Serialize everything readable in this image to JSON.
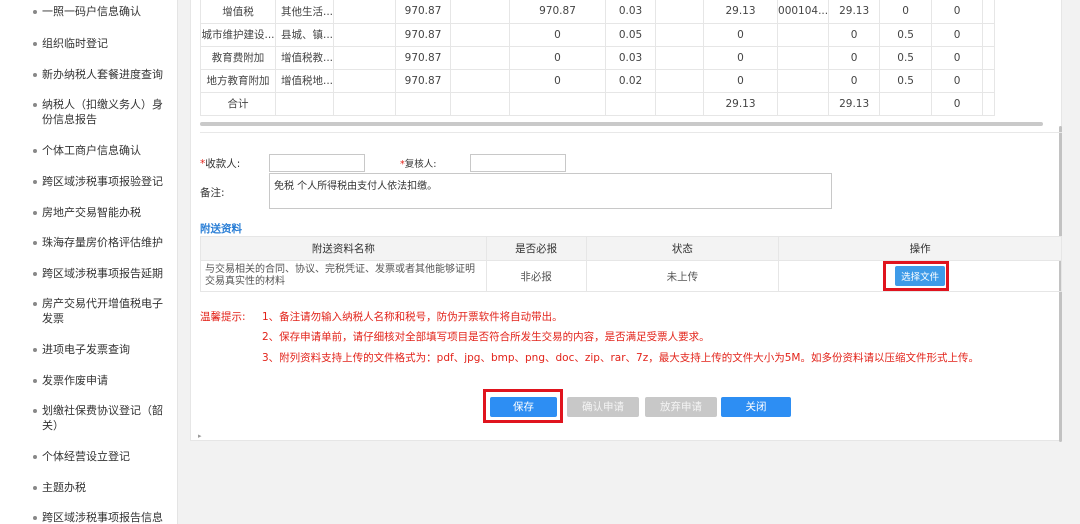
{
  "sidebar": {
    "items": [
      {
        "label": "一照一码户信息确认"
      },
      {
        "label": "组织临时登记"
      },
      {
        "label": "新办纳税人套餐进度查询"
      },
      {
        "label": "纳税人（扣缴义务人）身份信息报告"
      },
      {
        "label": "个体工商户信息确认"
      },
      {
        "label": "跨区域涉税事项报验登记"
      },
      {
        "label": "房地产交易智能办税"
      },
      {
        "label": "珠海存量房价格评估维护"
      },
      {
        "label": "跨区域涉税事项报告延期"
      },
      {
        "label": "房产交易代开增值税电子发票"
      },
      {
        "label": "进项电子发票查询"
      },
      {
        "label": "发票作废申请"
      },
      {
        "label": "划缴社保费协议登记（韶关）"
      },
      {
        "label": "个体经营设立登记"
      },
      {
        "label": "主题办税"
      },
      {
        "label": "跨区域涉税事项报告信息"
      }
    ]
  },
  "tax_table": {
    "rows": [
      [
        "增值税",
        "其他生活...",
        "",
        "970.87",
        "",
        "970.87",
        "0.03",
        "",
        "29.13",
        "000104...",
        "29.13",
        "0",
        "0"
      ],
      [
        "城市维护建设...",
        "县城、镇...",
        "",
        "970.87",
        "",
        "0",
        "0.05",
        "",
        "0",
        "",
        "0",
        "0.5",
        "0"
      ],
      [
        "教育费附加",
        "增值税教...",
        "",
        "970.87",
        "",
        "0",
        "0.03",
        "",
        "0",
        "",
        "0",
        "0.5",
        "0"
      ],
      [
        "地方教育附加",
        "增值税地...",
        "",
        "970.87",
        "",
        "0",
        "0.02",
        "",
        "0",
        "",
        "0",
        "0.5",
        "0"
      ],
      [
        "合计",
        "",
        "",
        "",
        "",
        "",
        "",
        "",
        "29.13",
        "",
        "29.13",
        "",
        "0"
      ]
    ]
  },
  "form": {
    "payee_label": "收款人:",
    "payee_value": "",
    "reviewer_label": "复核人:",
    "reviewer_value": "",
    "remark_label": "备注:",
    "remark_value": "免税 个人所得税由支付人依法扣缴。",
    "required_mark": "*"
  },
  "attachments": {
    "section_title": "附送资料",
    "headers": [
      "附送资料名称",
      "是否必报",
      "状态",
      "操作"
    ],
    "rows": [
      {
        "name": "与交易相关的合同、协议、完税凭证、发票或者其他能够证明交易真实性的材料",
        "required": "非必报",
        "status": "未上传",
        "action": "选择文件"
      }
    ]
  },
  "tips": {
    "heading": "温馨提示:",
    "lines": [
      "1、备注请勿输入纳税人名称和税号，防伪开票软件将自动带出。",
      "2、保存申请单前，请仔细核对全部填写项目是否符合所发生交易的内容，是否满足受票人要求。",
      "3、附列资料支持上传的文件格式为：pdf、jpg、bmp、png、doc、zip、rar、7z，最大支持上传的文件大小为5M。如多份资料请以压缩文件形式上传。"
    ]
  },
  "buttons": {
    "save": "保存",
    "confirm": "确认申请",
    "abandon": "放弃申请",
    "close": "关闭"
  },
  "colors": {
    "accent": "#2d8ef3",
    "highlight": "#e0141e",
    "warning": "#e2231a"
  }
}
